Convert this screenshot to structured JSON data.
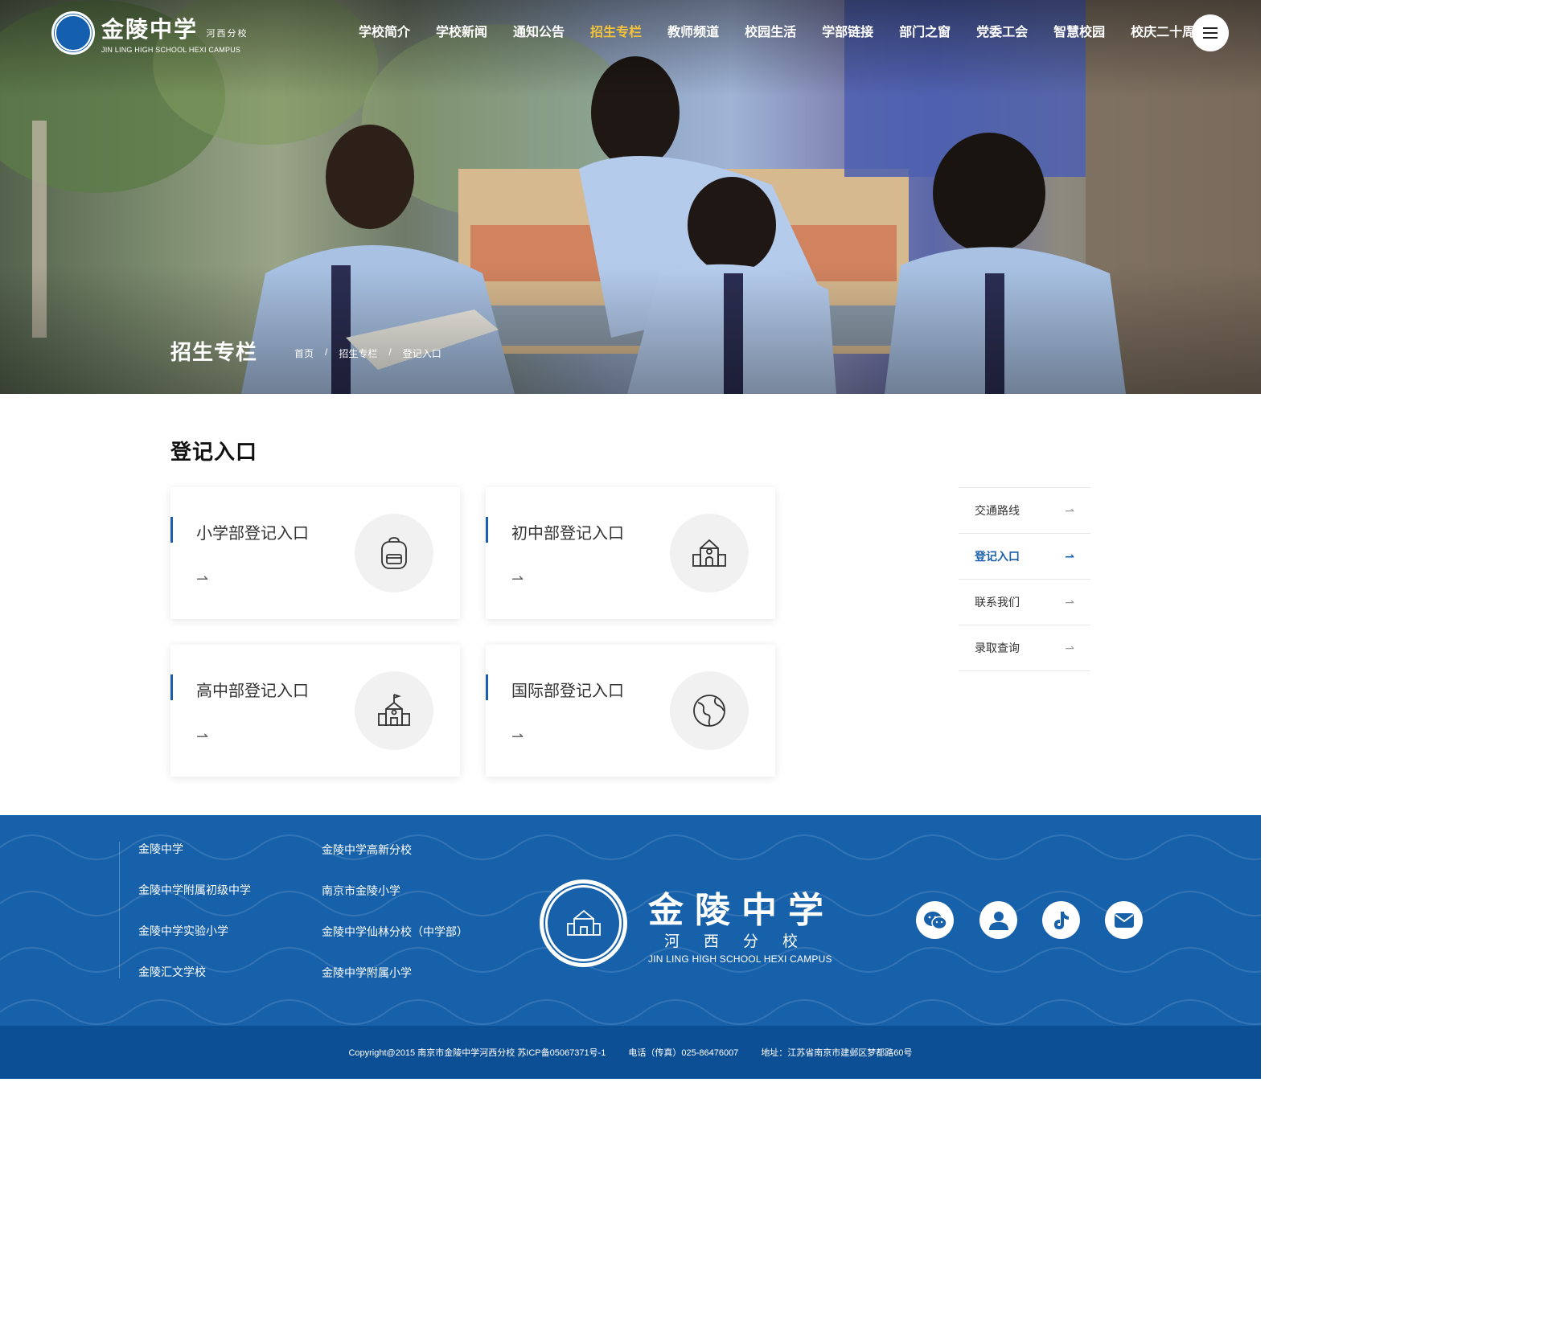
{
  "header": {
    "logo_cn": "金陵中学",
    "logo_branch": "河西分校",
    "logo_en": "JIN LING HIGH SCHOOL HEXI CAMPUS",
    "nav": [
      {
        "label": "学校简介"
      },
      {
        "label": "学校新闻"
      },
      {
        "label": "通知公告"
      },
      {
        "label": "招生专栏",
        "active": true
      },
      {
        "label": "教师频道"
      },
      {
        "label": "校园生活"
      },
      {
        "label": "学部链接"
      },
      {
        "label": "部门之窗"
      },
      {
        "label": "党委工会"
      },
      {
        "label": "智慧校园"
      },
      {
        "label": "校庆二十周年"
      }
    ],
    "menu_icon": "hamburger-menu-icon",
    "accent_color": "#f5c33a"
  },
  "banner": {
    "title": "招生专栏",
    "breadcrumb": [
      "首页",
      "招生专栏",
      "登记入口"
    ],
    "separator": "/"
  },
  "main": {
    "heading": "登记入口",
    "cards": [
      {
        "title": "小学部登记入口",
        "icon": "backpack-icon",
        "arrow": "⇀"
      },
      {
        "title": "初中部登记入口",
        "icon": "school-building-icon",
        "arrow": "⇀"
      },
      {
        "title": "高中部登记入口",
        "icon": "schoolhouse-flag-icon",
        "arrow": "⇀"
      },
      {
        "title": "国际部登记入口",
        "icon": "globe-icon",
        "arrow": "⇀"
      }
    ]
  },
  "sidebar": {
    "items": [
      {
        "label": "交通路线",
        "arrow": "⇀"
      },
      {
        "label": "登记入口",
        "arrow": "⇀",
        "active": true
      },
      {
        "label": "联系我们",
        "arrow": "⇀"
      },
      {
        "label": "录取查询",
        "arrow": "⇀"
      }
    ],
    "active_color": "#1a5fae"
  },
  "footer": {
    "links_col1": [
      "金陵中学",
      "金陵中学附属初级中学",
      "金陵中学实验小学",
      "金陵汇文学校"
    ],
    "links_col2": [
      "金陵中学高新分校",
      "南京市金陵小学",
      "金陵中学仙林分校（中学部）",
      "金陵中学附属小学"
    ],
    "logo_cn": "金陵中学",
    "logo_branch": "河西分校",
    "logo_en": "JIN LING HIGH SCHOOL HEXI CAMPUS",
    "social_icons": [
      "wechat-icon",
      "user-icon",
      "tiktok-icon",
      "mail-icon"
    ],
    "background_color": "#1761ab"
  },
  "bottom": {
    "copyright": "Copyright@2015 南京市金陵中学河西分校  苏ICP备05067371号-1",
    "phone": "电话（传真）025-86476007",
    "address": "地址：江苏省南京市建邺区梦都路60号",
    "background_color": "#0d4f94"
  }
}
